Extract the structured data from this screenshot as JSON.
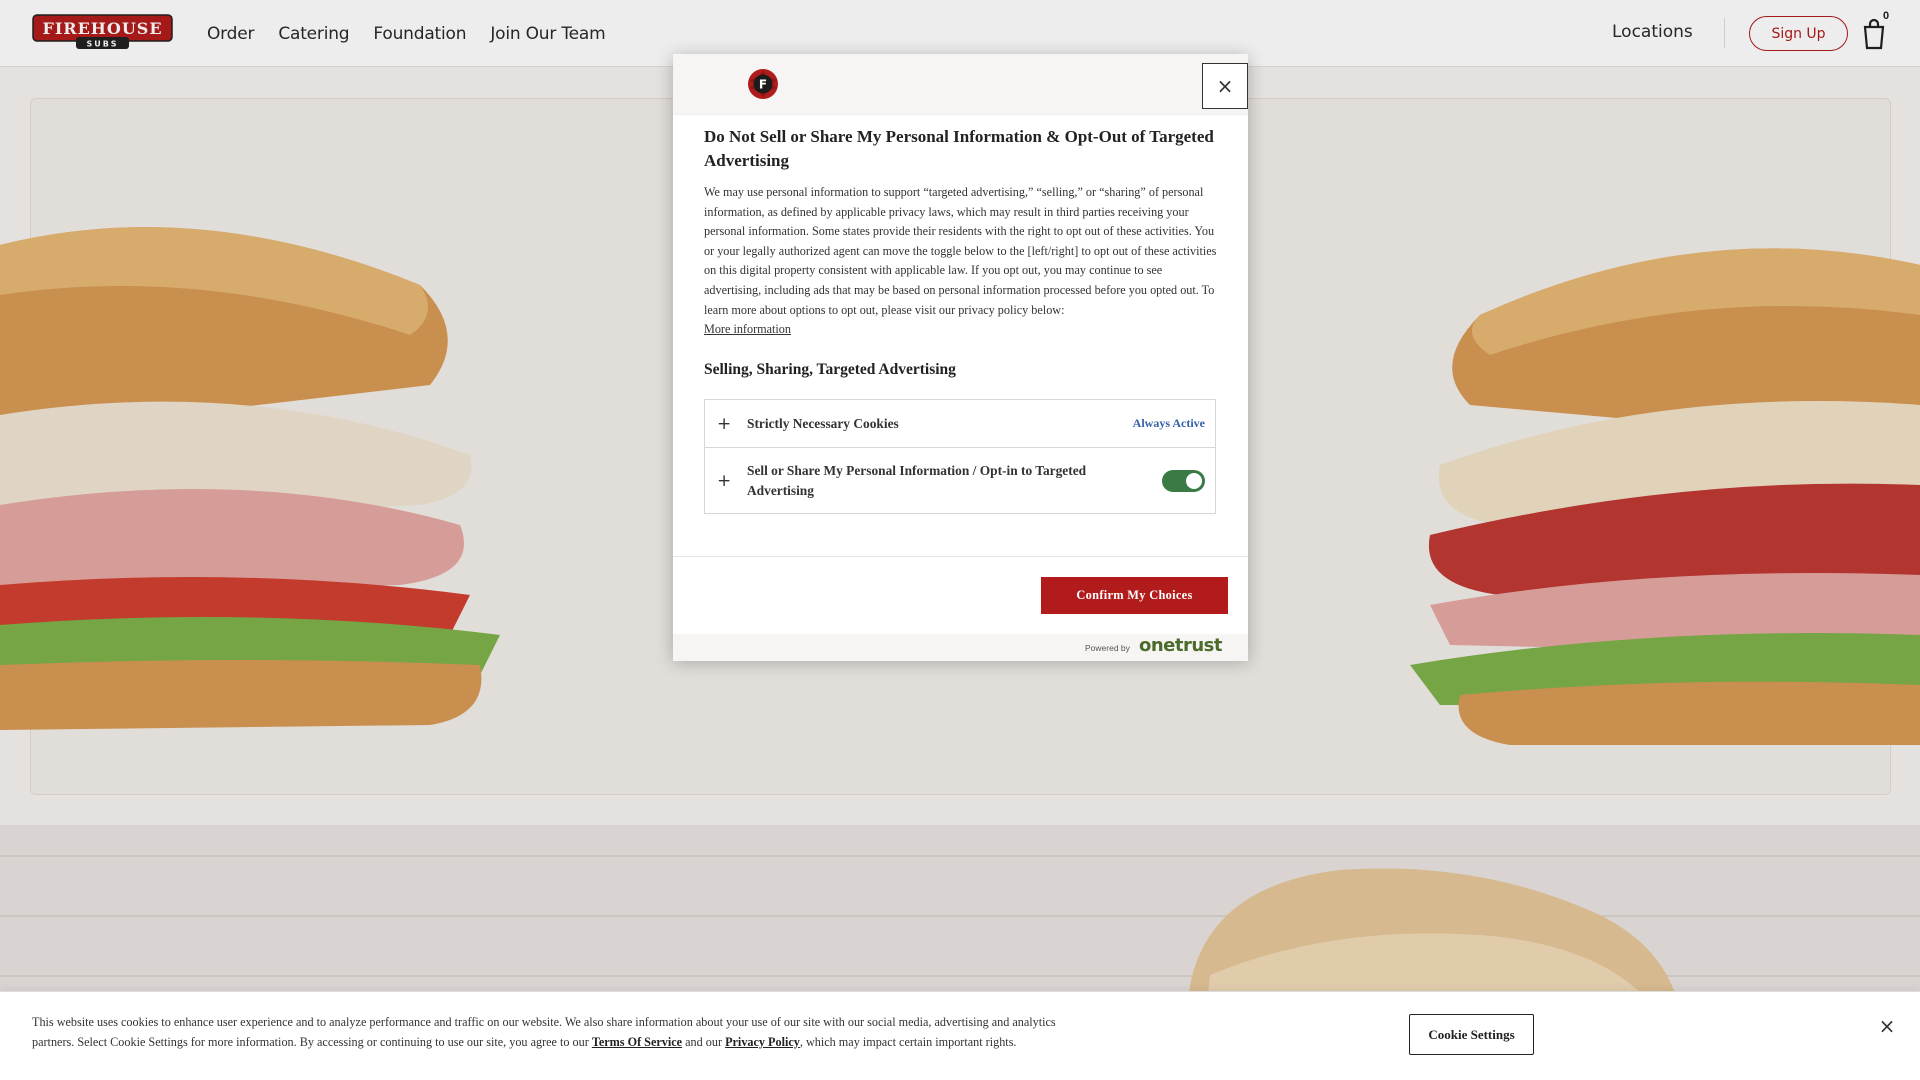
{
  "header": {
    "logo_text": "FIREHOUSE",
    "logo_subtext": "SUBS",
    "nav": [
      "Order",
      "Catering",
      "Foundation",
      "Join Our Team"
    ],
    "locations": "Locations",
    "signup": "Sign Up",
    "cart_count": "0"
  },
  "modal": {
    "title": "Do Not Sell or Share My Personal Information & Opt-Out of Targeted Advertising",
    "description": "We may use personal information to support “targeted advertising,” “selling,” or “sharing” of personal information, as defined by applicable privacy laws, which may result in third parties receiving your personal information. Some states provide their residents with the right to opt out of these activities. You or your legally authorized agent can move the toggle below to the [left/right] to opt out of these activities on this digital property consistent with applicable law. If you opt out, you may continue to see advertising, including ads that may be based on personal information processed before you opted out. To learn more about options to opt out, please visit our privacy policy below:",
    "more_info": "More information",
    "section_title": "Selling, Sharing, Targeted Advertising",
    "rows": [
      {
        "label": "Strictly Necessary Cookies",
        "status": "Always Active"
      },
      {
        "label": "Sell or Share My Personal Information / Opt-in to Targeted Advertising",
        "toggle_on": true
      }
    ],
    "close": "×",
    "confirm": "Confirm My Choices",
    "powered_by": "Powered by",
    "powered_brand": "onetrust"
  },
  "cookie_banner": {
    "text_part1": "This website uses cookies to enhance user experience and to analyze performance and traffic on our website. We also share information about your use of our site with our social media, advertising and analytics partners. Select Cookie Settings for more information. By accessing or continuing to use our site, you agree to our ",
    "terms": "Terms Of Service",
    "text_part2": " and our ",
    "privacy": "Privacy Policy",
    "text_part3": ", which may impact certain important rights.",
    "settings_button": "Cookie Settings",
    "close": "×"
  },
  "colors": {
    "brand_red": "#b21b1b",
    "toggle_green": "#3a7b45",
    "link_blue": "#3460a8"
  }
}
